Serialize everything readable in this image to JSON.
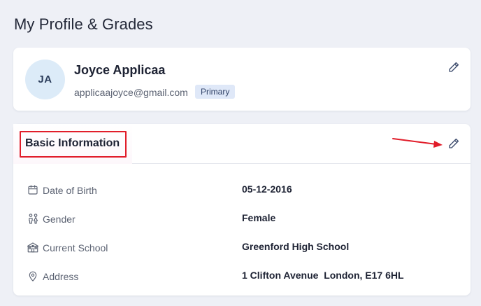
{
  "page": {
    "title": "My Profile & Grades"
  },
  "profile": {
    "initials": "JA",
    "name": "Joyce Applicaa",
    "email": "applicaajoyce@gmail.com",
    "badge": "Primary",
    "edit_icon": "pencil-icon"
  },
  "basic_info": {
    "title": "Basic Information",
    "edit_icon": "pencil-icon",
    "annotation_color": "#e11d2a",
    "rows": [
      {
        "icon": "calendar-icon",
        "label": "Date of Birth",
        "value": "05-12-2016"
      },
      {
        "icon": "people-icon",
        "label": "Gender",
        "value": "Female"
      },
      {
        "icon": "school-icon",
        "label": "Current School",
        "value": "Greenford High School"
      },
      {
        "icon": "location-pin-icon",
        "label": "Address",
        "value": "1 Clifton Avenue  London, E17 6HL"
      }
    ]
  }
}
